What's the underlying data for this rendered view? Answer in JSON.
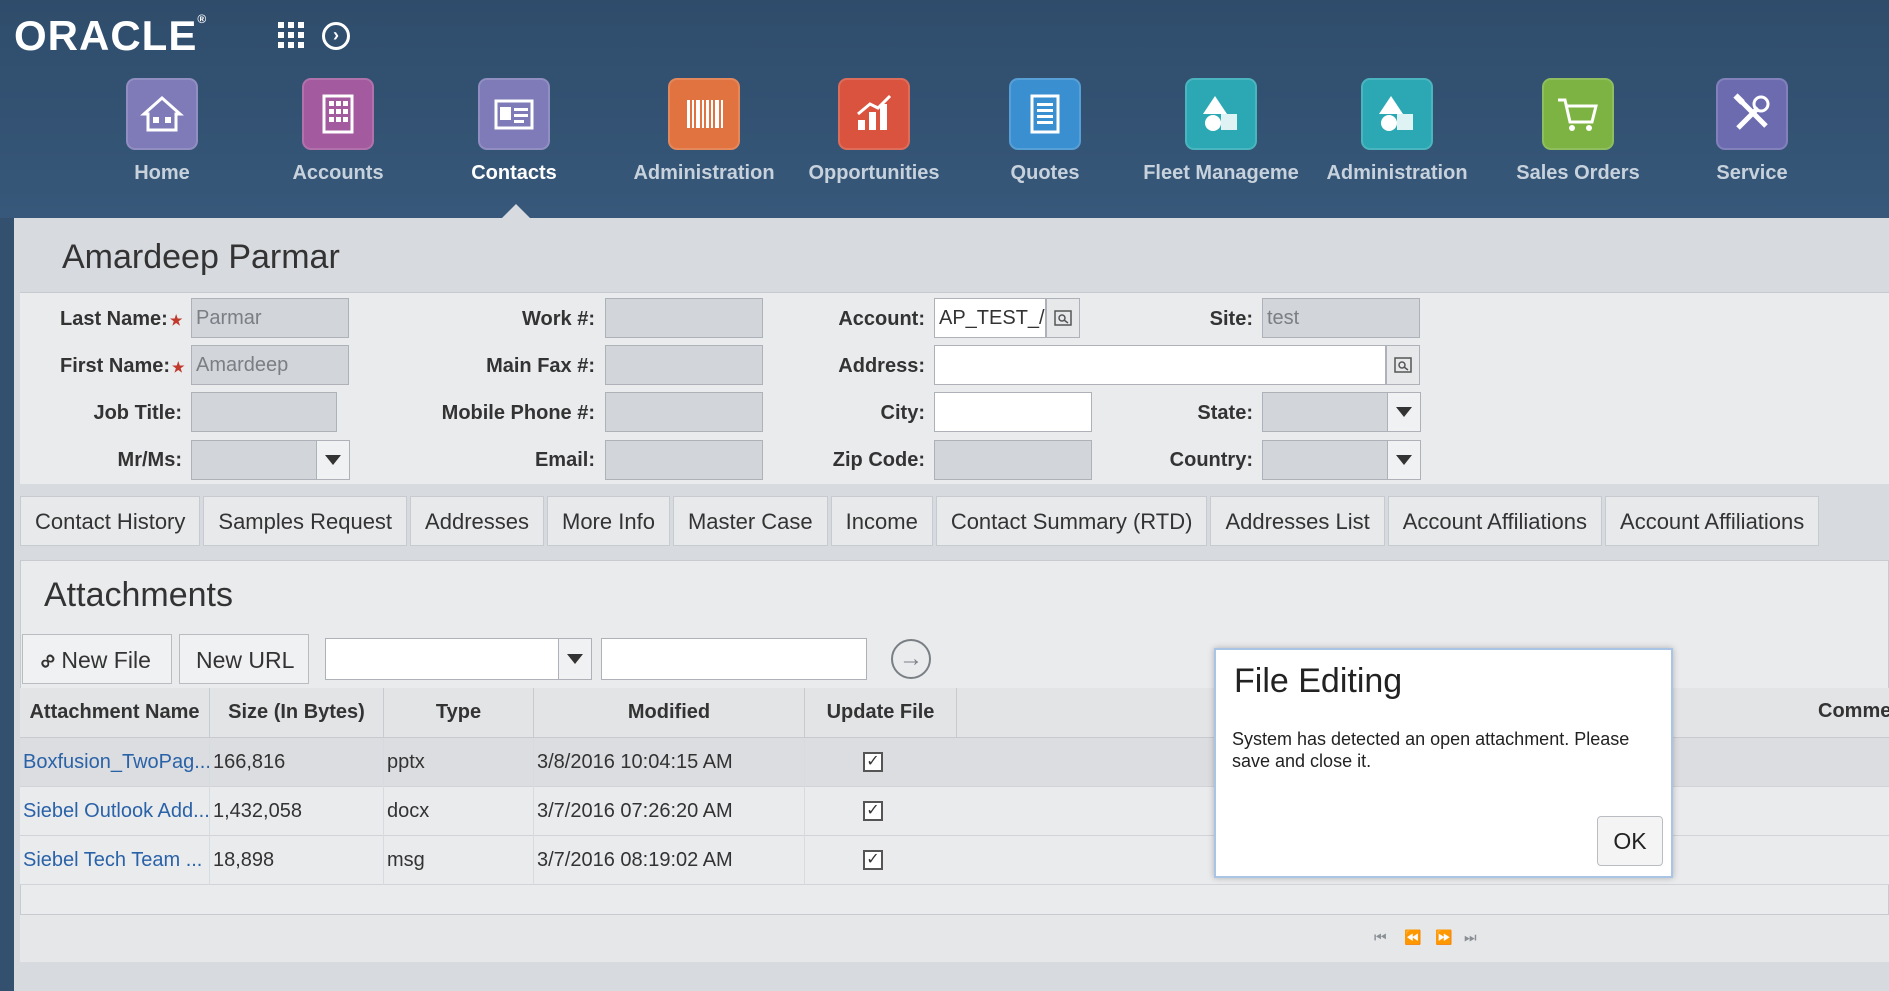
{
  "brand": {
    "logo_text": "ORACLE"
  },
  "nav": {
    "items": [
      {
        "label": "Home",
        "icon": "home-icon",
        "color": "#7e7bb8"
      },
      {
        "label": "Accounts",
        "icon": "building-icon",
        "color": "#a45a9e"
      },
      {
        "label": "Contacts",
        "icon": "contact-card-icon",
        "color": "#7e7bb8",
        "active": true
      },
      {
        "label": "Administration",
        "icon": "barcode-icon",
        "color": "#e0733f"
      },
      {
        "label": "Opportunities",
        "icon": "bar-chart-icon",
        "color": "#d9533e"
      },
      {
        "label": "Quotes",
        "icon": "document-icon",
        "color": "#3a8fd0"
      },
      {
        "label": "Fleet Manageme",
        "icon": "shapes-icon",
        "color": "#2ba8b3"
      },
      {
        "label": "Administration",
        "icon": "shapes-icon",
        "color": "#2ba8b3"
      },
      {
        "label": "Sales Orders",
        "icon": "cart-icon",
        "color": "#7cb342"
      },
      {
        "label": "Service",
        "icon": "tools-icon",
        "color": "#6d6bb0"
      }
    ]
  },
  "contact": {
    "name": "Amardeep Parmar",
    "fields": {
      "last_name_label": "Last Name:",
      "last_name": "Parmar",
      "first_name_label": "First Name:",
      "first_name": "Amardeep",
      "job_title_label": "Job Title:",
      "mrms_label": "Mr/Ms:",
      "work_label": "Work #:",
      "fax_label": "Main Fax #:",
      "mobile_label": "Mobile Phone #:",
      "email_label": "Email:",
      "account_label": "Account:",
      "account": "AP_TEST_/",
      "address_label": "Address:",
      "city_label": "City:",
      "zip_label": "Zip Code:",
      "site_label": "Site:",
      "site": "test",
      "state_label": "State:",
      "country_label": "Country:"
    }
  },
  "tabs": [
    "Contact History",
    "Samples Request",
    "Addresses",
    "More Info",
    "Master Case",
    "Income",
    "Contact Summary (RTD)",
    "Addresses List",
    "Account Affiliations",
    "Account Affiliations"
  ],
  "attachments": {
    "title": "Attachments",
    "new_file": "New File",
    "new_url": "New URL",
    "columns": [
      "Attachment Name",
      "Size (In Bytes)",
      "Type",
      "Modified",
      "Update File"
    ],
    "comments_col": "Comme",
    "rows": [
      {
        "name": "Boxfusion_TwoPag...",
        "size": "166,816",
        "type": "pptx",
        "modified": "3/8/2016 10:04:15 AM",
        "checked": "✓"
      },
      {
        "name": "Siebel Outlook Add...",
        "size": "1,432,058",
        "type": "docx",
        "modified": "3/7/2016 07:26:20 AM",
        "checked": "✓"
      },
      {
        "name": "Siebel Tech Team ...",
        "size": "18,898",
        "type": "msg",
        "modified": "3/7/2016 08:19:02 AM",
        "checked": "✓"
      }
    ]
  },
  "dialog": {
    "title": "File Editing",
    "message": "System has detected an open attachment. Please save and close it.",
    "ok": "OK"
  }
}
